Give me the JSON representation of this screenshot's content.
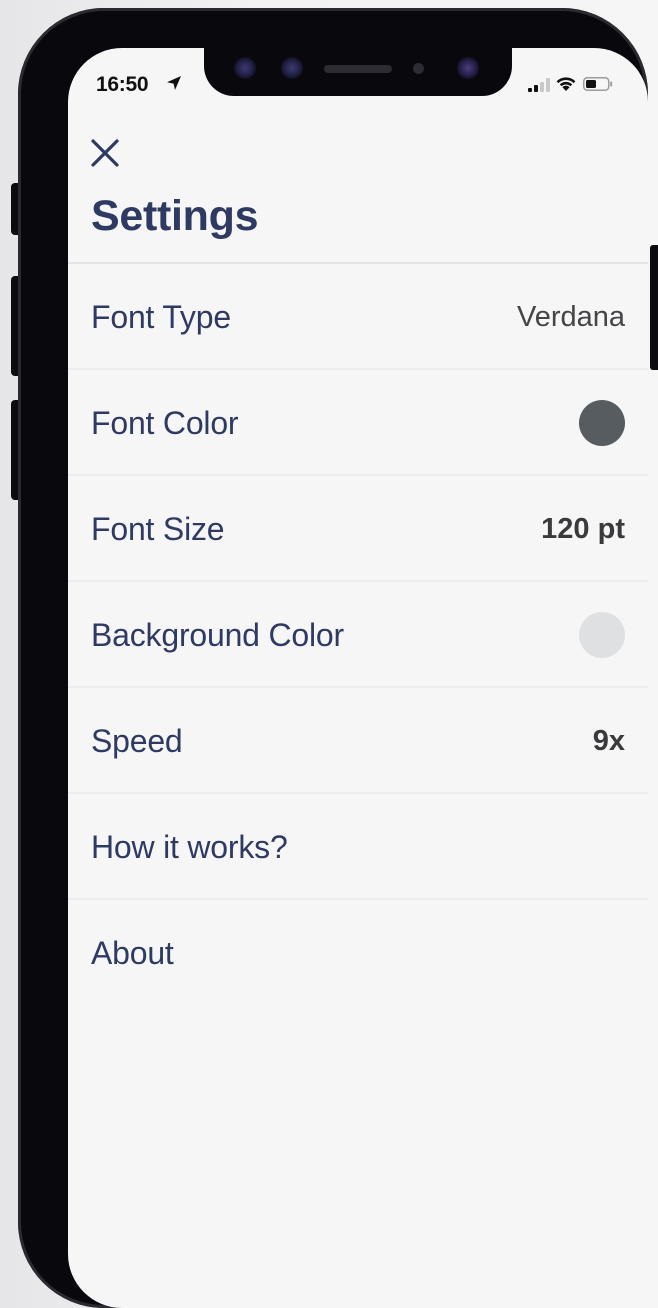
{
  "status_bar": {
    "time": "16:50"
  },
  "header": {
    "title": "Settings",
    "close_icon": "close-icon"
  },
  "settings": {
    "font_type": {
      "label": "Font Type",
      "value": "Verdana"
    },
    "font_color": {
      "label": "Font Color",
      "swatch_color": "#575c60"
    },
    "font_size": {
      "label": "Font Size",
      "value": "120 pt"
    },
    "background_color": {
      "label": "Background Color",
      "swatch_color": "#dfe0e2"
    },
    "speed": {
      "label": "Speed",
      "value": "9x"
    },
    "how_it_works": {
      "label": "How it works?"
    },
    "about": {
      "label": "About"
    }
  },
  "colors": {
    "text_primary": "#2f3a62",
    "background": "#f6f6f7"
  }
}
